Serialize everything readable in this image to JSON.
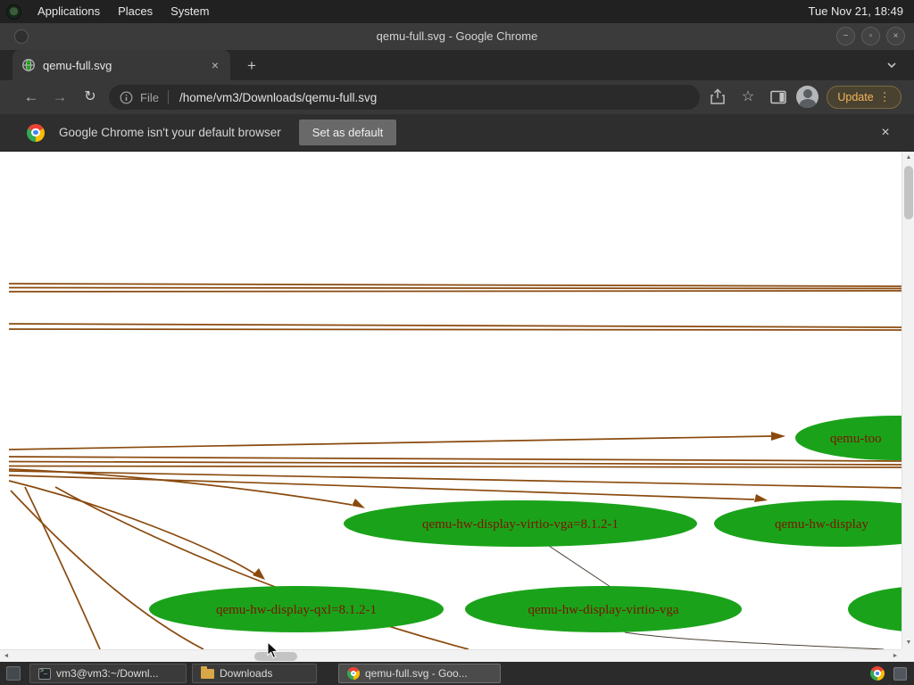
{
  "panel": {
    "menus": [
      {
        "label": "Applications"
      },
      {
        "label": "Places"
      },
      {
        "label": "System"
      }
    ],
    "clock": "Tue Nov 21, 18:49"
  },
  "window": {
    "title": "qemu-full.svg - Google Chrome",
    "controls": {
      "minimize": "−",
      "maximize": "▫",
      "close": "×"
    }
  },
  "tabstrip": {
    "tab": {
      "label": "qemu-full.svg",
      "close": "×"
    },
    "new_tab": "+"
  },
  "toolbar": {
    "back": "←",
    "forward": "→",
    "reload": "↻",
    "omnibox": {
      "chip": "File",
      "path": "/home/vm3/Downloads/qemu-full.svg"
    },
    "bookmark_star": "☆",
    "update": {
      "label": "Update",
      "menu": "⋮"
    }
  },
  "infobar": {
    "message": "Google Chrome isn't your default browser",
    "action": "Set as default",
    "close": "×"
  },
  "graph": {
    "colors": {
      "node_fill": "#1aa31a",
      "node_text": "#7b1502",
      "edge": "#8a4a0e"
    },
    "nodes": [
      {
        "label": "qemu-too"
      },
      {
        "label": "qemu-hw-display-virtio-vga=8.1.2-1"
      },
      {
        "label": "qemu-hw-display"
      },
      {
        "label": "qemu-hw-display-qxl=8.1.2-1"
      },
      {
        "label": "qemu-hw-display-virtio-vga"
      },
      {
        "label": ""
      }
    ]
  },
  "scrollbars": {
    "up": "▲",
    "down": "▼",
    "left": "◄",
    "right": "►"
  },
  "taskbar": {
    "items": [
      {
        "label": "vm3@vm3:~/Downl..."
      },
      {
        "label": "Downloads"
      },
      {
        "label": "qemu-full.svg - Goo..."
      }
    ]
  }
}
